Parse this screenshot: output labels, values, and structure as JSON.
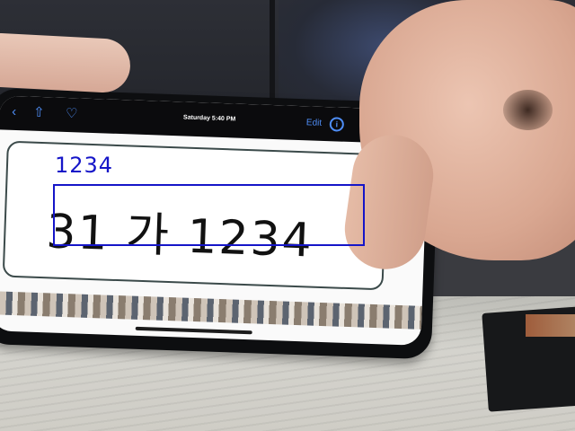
{
  "phone_ui": {
    "status_title": "Saturday 5:40 PM",
    "edit_label": "Edit",
    "back_icon": "chevron-left-icon",
    "share_icon": "share-icon",
    "favorite_icon": "heart-icon",
    "info_icon": "info-icon"
  },
  "plate": {
    "text": "31 가 1234"
  },
  "detection": {
    "label": "1234",
    "box_color": "#1515c8"
  }
}
